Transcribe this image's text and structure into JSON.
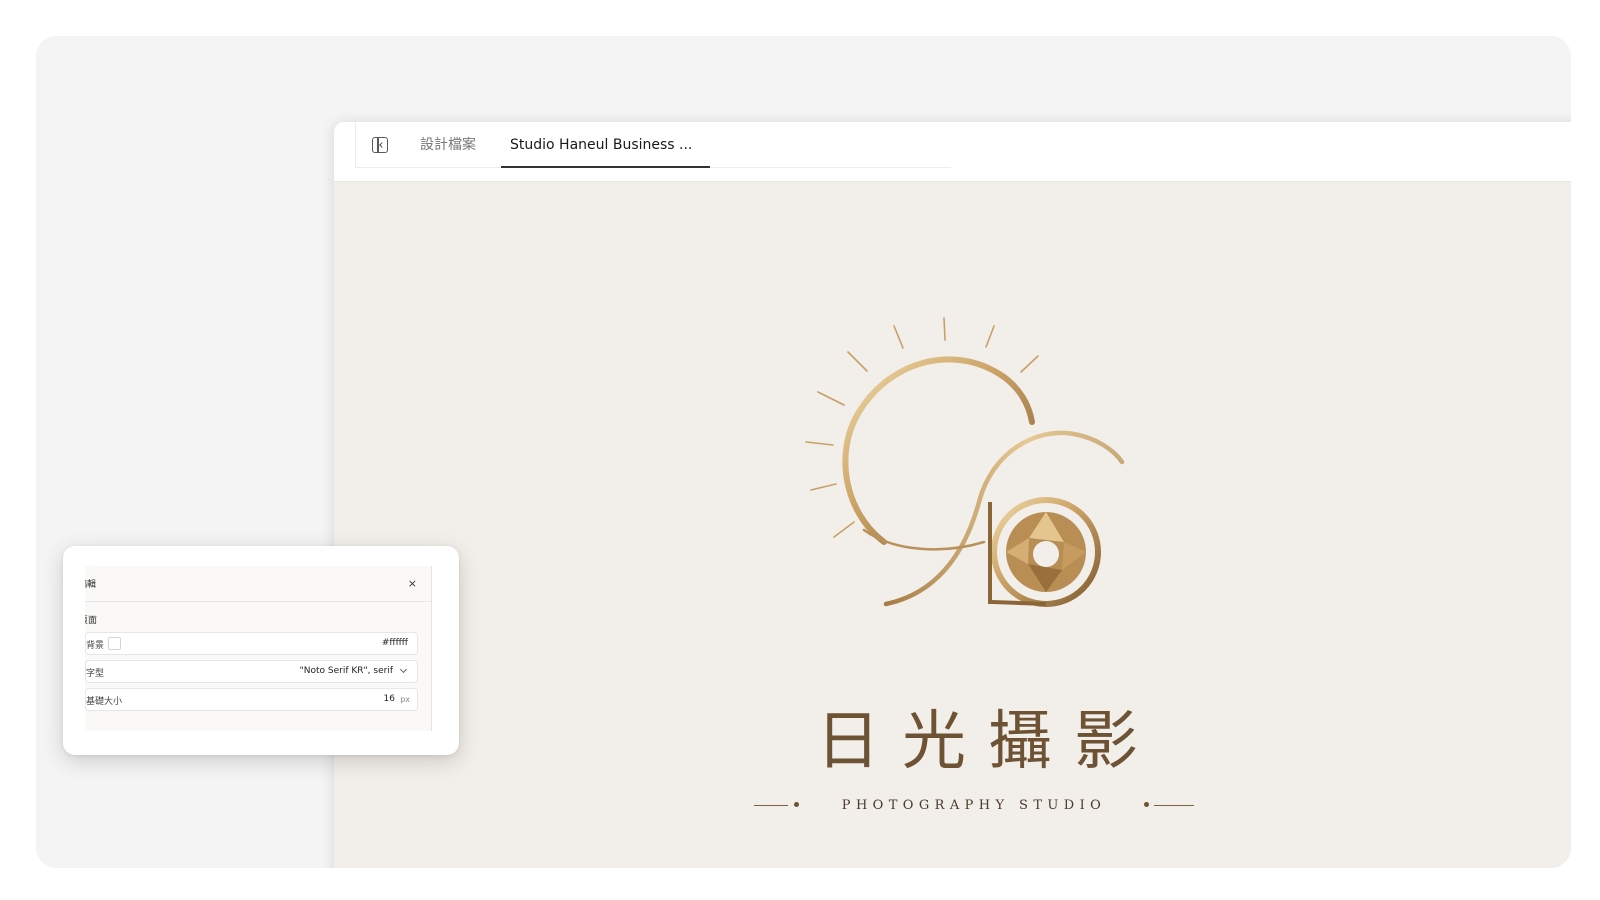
{
  "tabs": {
    "panel_toggle_icon": "sidebar-toggle-icon",
    "files_label": "設計檔案",
    "active_label": "Studio Haneul Business ..."
  },
  "logo": {
    "title": "日光攝影",
    "tagline": "PHOTOGRAPHY STUDIO",
    "colors": {
      "gold_light": "#f0d9a6",
      "gold_mid": "#c9a064",
      "gold_dark": "#7d5a30",
      "text": "#6e5234"
    }
  },
  "settings": {
    "title": "編輯",
    "close_icon": "×",
    "section": "頁面",
    "background_label": "背景",
    "background_value": "#ffffff",
    "font_label": "字型",
    "font_value": "\"Noto Serif KR\", serif",
    "base_size_label": "基礎大小",
    "base_size_value": "16",
    "base_size_unit": "px"
  }
}
